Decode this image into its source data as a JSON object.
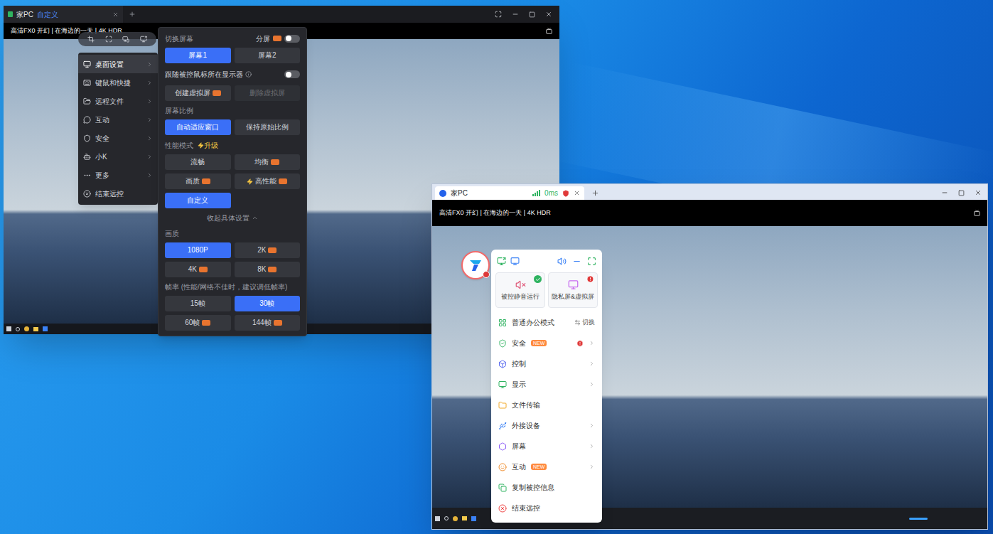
{
  "dark_window": {
    "tab": {
      "title": "家PC",
      "mode": "自定义"
    },
    "video_title": "高清FX0 开幻 | 在海边的一天 | 4K HDR",
    "side_menu": [
      {
        "label": "桌面设置",
        "selected": true,
        "arrow": true
      },
      {
        "label": "键鼠和快捷",
        "selected": false,
        "arrow": true
      },
      {
        "label": "远程文件",
        "selected": false,
        "arrow": true
      },
      {
        "label": "互动",
        "selected": false,
        "arrow": true
      },
      {
        "label": "安全",
        "selected": false,
        "arrow": true
      },
      {
        "label": "小K",
        "selected": false,
        "arrow": true
      },
      {
        "label": "更多",
        "selected": false,
        "arrow": true
      },
      {
        "label": "结束远控",
        "selected": false,
        "arrow": false
      }
    ],
    "settings": {
      "screen": {
        "title": "切换屏幕",
        "split": {
          "label": "分屏",
          "vip": true,
          "on": false
        },
        "options": [
          {
            "label": "屏幕1",
            "selected": true,
            "vip": false,
            "disabled": false,
            "boost": false
          },
          {
            "label": "屏幕2",
            "selected": false,
            "vip": false,
            "disabled": false,
            "boost": false
          }
        ]
      },
      "follow": {
        "label": "跟随被控鼠标所在显示器",
        "on": false
      },
      "virtual": [
        {
          "label": "创建虚拟屏",
          "selected": false,
          "vip": true,
          "disabled": false,
          "boost": false
        },
        {
          "label": "删除虚拟屏",
          "selected": false,
          "vip": false,
          "disabled": true,
          "boost": false
        }
      ],
      "ratio": {
        "title": "屏幕比例",
        "options": [
          {
            "label": "自动适应窗口",
            "selected": true,
            "vip": false,
            "disabled": false,
            "boost": false
          },
          {
            "label": "保持原始比例",
            "selected": false,
            "vip": false,
            "disabled": false,
            "boost": false
          }
        ]
      },
      "performance": {
        "title": "性能模式",
        "upgrade": "升级",
        "options": [
          {
            "label": "流畅",
            "selected": false,
            "vip": false,
            "disabled": false,
            "boost": false
          },
          {
            "label": "均衡",
            "selected": false,
            "vip": true,
            "disabled": false,
            "boost": false
          },
          {
            "label": "画质",
            "selected": false,
            "vip": true,
            "disabled": false,
            "boost": false
          },
          {
            "label": "高性能",
            "selected": false,
            "vip": true,
            "disabled": false,
            "boost": true
          },
          {
            "label": "自定义",
            "selected": true,
            "vip": false,
            "disabled": false,
            "boost": false
          }
        ]
      },
      "collapse": "收起具体设置",
      "quality": {
        "title": "画质",
        "options": [
          {
            "label": "1080P",
            "selected": true,
            "vip": false,
            "disabled": false,
            "boost": false
          },
          {
            "label": "2K",
            "selected": false,
            "vip": true,
            "disabled": false,
            "boost": false
          },
          {
            "label": "4K",
            "selected": false,
            "vip": true,
            "disabled": false,
            "boost": false
          },
          {
            "label": "8K",
            "selected": false,
            "vip": true,
            "disabled": false,
            "boost": false
          }
        ]
      },
      "framerate": {
        "title": "帧率 (性能/网络不佳时，建议调低帧率)",
        "options": [
          {
            "label": "15帧",
            "selected": false,
            "vip": false,
            "disabled": false,
            "boost": false
          },
          {
            "label": "30帧",
            "selected": true,
            "vip": false,
            "disabled": false,
            "boost": false
          },
          {
            "label": "60帧",
            "selected": false,
            "vip": true,
            "disabled": false,
            "boost": false
          },
          {
            "label": "144帧",
            "selected": false,
            "vip": true,
            "disabled": false,
            "boost": false
          }
        ]
      }
    }
  },
  "light_window": {
    "tab": {
      "title": "家PC",
      "latency": "0ms"
    },
    "video_title": "高清FX0 开幻 | 在海边的一天 | 4K HDR",
    "logo_badge": true,
    "quick_cards": [
      {
        "label": "被控静音运行",
        "status": "ok"
      },
      {
        "label": "隐私屏&虚拟屏",
        "status": "alert"
      }
    ],
    "menu": [
      {
        "label": "普通办公模式",
        "tag": "",
        "alert": false,
        "arrow": false,
        "action": "切换"
      },
      {
        "label": "安全",
        "tag": "NEW",
        "alert": true,
        "arrow": true,
        "action": ""
      },
      {
        "label": "控制",
        "tag": "",
        "alert": false,
        "arrow": true,
        "action": ""
      },
      {
        "label": "显示",
        "tag": "",
        "alert": false,
        "arrow": true,
        "action": ""
      },
      {
        "label": "文件传输",
        "tag": "",
        "alert": false,
        "arrow": false,
        "action": ""
      },
      {
        "label": "外接设备",
        "tag": "",
        "alert": false,
        "arrow": true,
        "action": ""
      },
      {
        "label": "屏幕",
        "tag": "",
        "alert": false,
        "arrow": true,
        "action": ""
      },
      {
        "label": "互动",
        "tag": "NEW",
        "alert": false,
        "arrow": true,
        "action": ""
      },
      {
        "label": "复制被控信息",
        "tag": "",
        "alert": false,
        "arrow": false,
        "action": ""
      },
      {
        "label": "结束远控",
        "tag": "",
        "alert": false,
        "arrow": false,
        "action": ""
      }
    ]
  }
}
